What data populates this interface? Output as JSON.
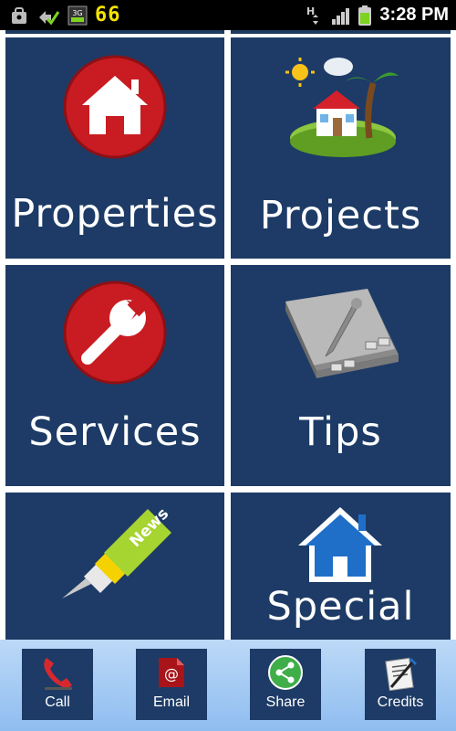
{
  "status_bar": {
    "notification_count": "66",
    "network": "3G",
    "data_indicator": "H",
    "time": "3:28 PM",
    "icons": [
      "bag-icon",
      "sync-icon",
      "3g-icon",
      "h-data-icon",
      "signal-icon",
      "battery-icon"
    ]
  },
  "tiles": [
    {
      "label": "Properties",
      "icon": "home-circle-icon"
    },
    {
      "label": "Projects",
      "icon": "island-house-icon"
    },
    {
      "label": "Services",
      "icon": "wrench-circle-icon"
    },
    {
      "label": "Tips",
      "icon": "notebook-pen-icon"
    },
    {
      "label": "News",
      "icon": "news-pen-icon"
    },
    {
      "label": "Special",
      "icon": "blue-house-icon"
    }
  ],
  "bottom_bar": {
    "buttons": [
      {
        "label": "Call",
        "icon": "phone-icon"
      },
      {
        "label": "Email",
        "icon": "email-icon"
      },
      {
        "label": "Share",
        "icon": "share-icon"
      },
      {
        "label": "Credits",
        "icon": "credits-icon"
      }
    ]
  },
  "colors": {
    "tile_background": "#1d3b66",
    "red_circle": "#c81c22",
    "bottom_bar": "#a8cdf4",
    "status_number": "#f4e300"
  }
}
